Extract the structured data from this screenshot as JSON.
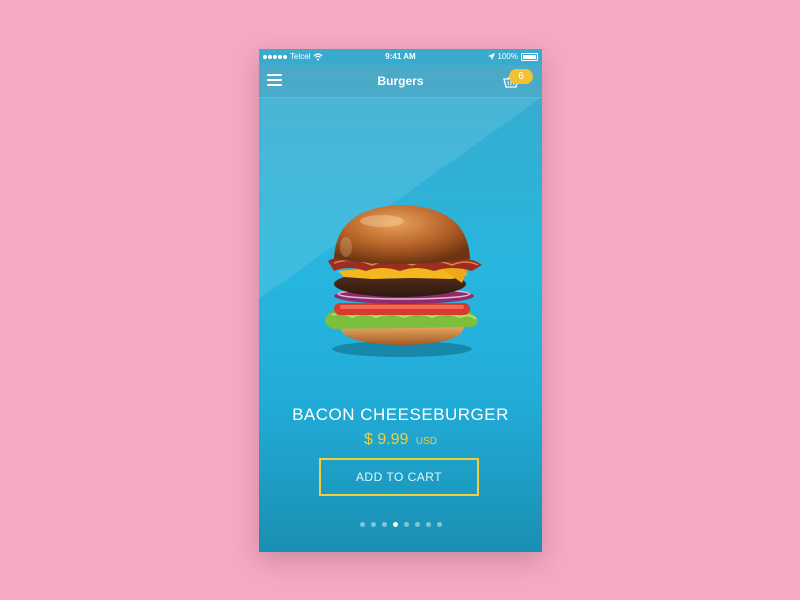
{
  "status_bar": {
    "carrier": "Telcel",
    "time": "9:41 AM",
    "battery": "100%"
  },
  "nav": {
    "title": "Burgers",
    "menu_icon": "hamburger-menu-icon",
    "cart_icon": "basket-icon",
    "cart_count": "6"
  },
  "product": {
    "name": "BACON CHEESEBURGER",
    "price": "$ 9.99",
    "currency": "USD",
    "image": "burger-image"
  },
  "actions": {
    "add_to_cart": "ADD TO CART"
  },
  "pager": {
    "count": 8,
    "active_index": 3
  },
  "colors": {
    "background": "#f7a8c2",
    "accent": "#f2cf3a",
    "primary": "#27b6de",
    "badge": "#f1c232"
  }
}
